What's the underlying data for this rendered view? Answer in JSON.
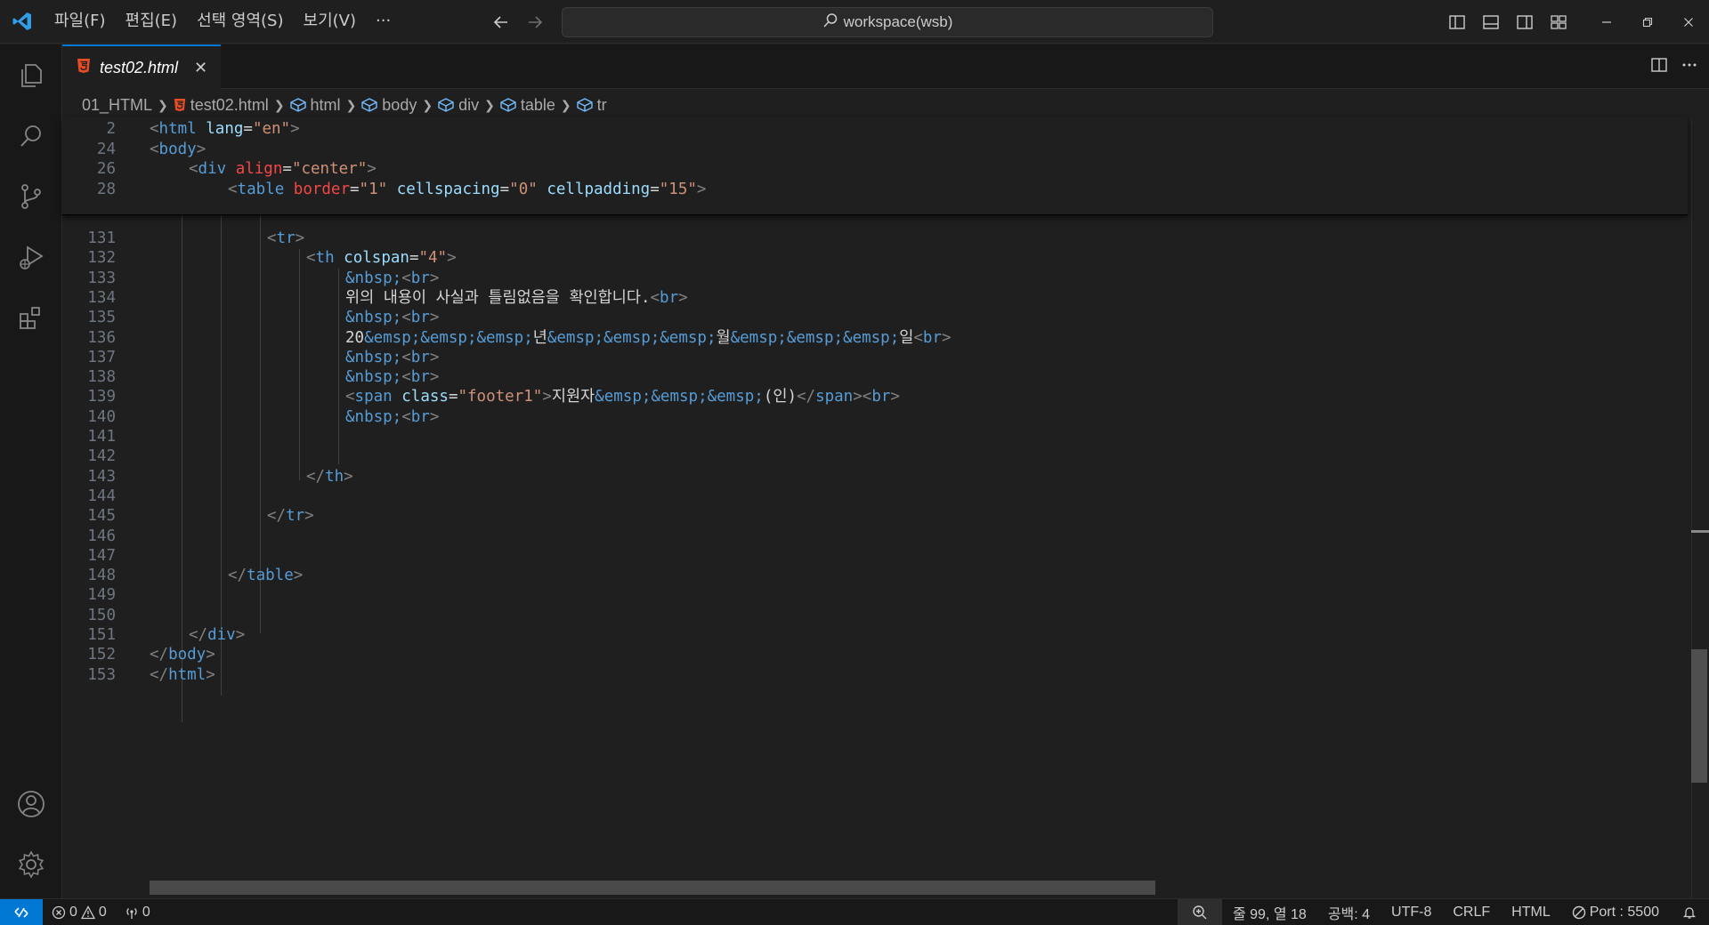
{
  "titlebar": {
    "menu": [
      "파일(F)",
      "편집(E)",
      "선택 영역(S)",
      "보기(V)",
      "···"
    ],
    "search_text": "workspace(wsb)",
    "window_controls": [
      "minimize-icon",
      "restore-icon",
      "close-icon"
    ]
  },
  "activity_bar": [
    "explorer-icon",
    "search-icon",
    "source-control-icon",
    "run-debug-icon",
    "extensions-icon",
    "account-icon",
    "settings-gear-icon"
  ],
  "tab": {
    "label": "test02.html",
    "close": "✕"
  },
  "breadcrumb": [
    "01_HTML",
    "test02.html",
    "html",
    "body",
    "div",
    "table",
    "tr"
  ],
  "sticky_lines": [
    {
      "n": "2",
      "indent": 0,
      "tokens": [
        [
          "br",
          "<"
        ],
        [
          "tag",
          "html"
        ],
        [
          "txt",
          " "
        ],
        [
          "attr",
          "lang"
        ],
        [
          "txt",
          "="
        ],
        [
          "str",
          "\"en\""
        ],
        [
          "br",
          ">"
        ]
      ]
    },
    {
      "n": "24",
      "indent": 0,
      "tokens": [
        [
          "br",
          "<"
        ],
        [
          "tag",
          "body"
        ],
        [
          "br",
          ">"
        ]
      ]
    },
    {
      "n": "26",
      "indent": 1,
      "tokens": [
        [
          "br",
          "<"
        ],
        [
          "tag",
          "div"
        ],
        [
          "txt",
          " "
        ],
        [
          "attrred",
          "align"
        ],
        [
          "txt",
          "="
        ],
        [
          "str",
          "\"center\""
        ],
        [
          "br",
          ">"
        ]
      ]
    },
    {
      "n": "28",
      "indent": 2,
      "tokens": [
        [
          "br",
          "<"
        ],
        [
          "tag",
          "table"
        ],
        [
          "txt",
          " "
        ],
        [
          "attrred",
          "border"
        ],
        [
          "txt",
          "="
        ],
        [
          "str",
          "\"1\""
        ],
        [
          "txt",
          " "
        ],
        [
          "attr",
          "cellspacing"
        ],
        [
          "txt",
          "="
        ],
        [
          "str",
          "\"0\""
        ],
        [
          "txt",
          " "
        ],
        [
          "attr",
          "cellpadding"
        ],
        [
          "txt",
          "="
        ],
        [
          "str",
          "\"15\""
        ],
        [
          "br",
          ">"
        ]
      ]
    }
  ],
  "lines": [
    {
      "n": "131",
      "indent": 3,
      "tokens": [
        [
          "br",
          "<"
        ],
        [
          "tag",
          "tr"
        ],
        [
          "br",
          ">"
        ]
      ]
    },
    {
      "n": "132",
      "indent": 4,
      "tokens": [
        [
          "br",
          "<"
        ],
        [
          "tag",
          "th"
        ],
        [
          "txt",
          " "
        ],
        [
          "attr",
          "colspan"
        ],
        [
          "txt",
          "="
        ],
        [
          "str",
          "\"4\""
        ],
        [
          "br",
          ">"
        ]
      ]
    },
    {
      "n": "133",
      "indent": 5,
      "tokens": [
        [
          "ent",
          "&nbsp;"
        ],
        [
          "br",
          "<"
        ],
        [
          "tag",
          "br"
        ],
        [
          "br",
          ">"
        ]
      ]
    },
    {
      "n": "134",
      "indent": 5,
      "tokens": [
        [
          "txt",
          "위의 내용이 사실과 틀림없음을 확인합니다."
        ],
        [
          "br",
          "<"
        ],
        [
          "tag",
          "br"
        ],
        [
          "br",
          ">"
        ]
      ]
    },
    {
      "n": "135",
      "indent": 5,
      "tokens": [
        [
          "ent",
          "&nbsp;"
        ],
        [
          "br",
          "<"
        ],
        [
          "tag",
          "br"
        ],
        [
          "br",
          ">"
        ]
      ]
    },
    {
      "n": "136",
      "indent": 5,
      "tokens": [
        [
          "txt",
          "20"
        ],
        [
          "ent",
          "&emsp;&emsp;&emsp;"
        ],
        [
          "txt",
          "년"
        ],
        [
          "ent",
          "&emsp;&emsp;&emsp;"
        ],
        [
          "txt",
          "월"
        ],
        [
          "ent",
          "&emsp;&emsp;&emsp;"
        ],
        [
          "txt",
          "일"
        ],
        [
          "br",
          "<"
        ],
        [
          "tag",
          "br"
        ],
        [
          "br",
          ">"
        ]
      ]
    },
    {
      "n": "137",
      "indent": 5,
      "tokens": [
        [
          "ent",
          "&nbsp;"
        ],
        [
          "br",
          "<"
        ],
        [
          "tag",
          "br"
        ],
        [
          "br",
          ">"
        ]
      ]
    },
    {
      "n": "138",
      "indent": 5,
      "tokens": [
        [
          "ent",
          "&nbsp;"
        ],
        [
          "br",
          "<"
        ],
        [
          "tag",
          "br"
        ],
        [
          "br",
          ">"
        ]
      ]
    },
    {
      "n": "139",
      "indent": 5,
      "tokens": [
        [
          "br",
          "<"
        ],
        [
          "tag",
          "span"
        ],
        [
          "txt",
          " "
        ],
        [
          "attr",
          "class"
        ],
        [
          "txt",
          "="
        ],
        [
          "str",
          "\"footer1\""
        ],
        [
          "br",
          ">"
        ],
        [
          "txt",
          "지원자"
        ],
        [
          "ent",
          "&emsp;&emsp;&emsp;"
        ],
        [
          "txt",
          "(인)"
        ],
        [
          "br",
          "</"
        ],
        [
          "tag",
          "span"
        ],
        [
          "br",
          ">"
        ],
        [
          "br",
          "<"
        ],
        [
          "tag",
          "br"
        ],
        [
          "br",
          ">"
        ]
      ]
    },
    {
      "n": "140",
      "indent": 5,
      "tokens": [
        [
          "ent",
          "&nbsp;"
        ],
        [
          "br",
          "<"
        ],
        [
          "tag",
          "br"
        ],
        [
          "br",
          ">"
        ]
      ]
    },
    {
      "n": "141",
      "indent": 0,
      "tokens": []
    },
    {
      "n": "142",
      "indent": 0,
      "tokens": []
    },
    {
      "n": "143",
      "indent": 4,
      "tokens": [
        [
          "br",
          "</"
        ],
        [
          "tag",
          "th"
        ],
        [
          "br",
          ">"
        ]
      ]
    },
    {
      "n": "144",
      "indent": 0,
      "tokens": []
    },
    {
      "n": "145",
      "indent": 3,
      "tokens": [
        [
          "br",
          "</"
        ],
        [
          "tag",
          "tr"
        ],
        [
          "br",
          ">"
        ]
      ]
    },
    {
      "n": "146",
      "indent": 0,
      "tokens": []
    },
    {
      "n": "147",
      "indent": 0,
      "tokens": []
    },
    {
      "n": "148",
      "indent": 2,
      "tokens": [
        [
          "br",
          "</"
        ],
        [
          "tag",
          "table"
        ],
        [
          "br",
          ">"
        ]
      ]
    },
    {
      "n": "149",
      "indent": 0,
      "tokens": []
    },
    {
      "n": "150",
      "indent": 0,
      "tokens": []
    },
    {
      "n": "151",
      "indent": 1,
      "tokens": [
        [
          "br",
          "</"
        ],
        [
          "tag",
          "div"
        ],
        [
          "br",
          ">"
        ]
      ]
    },
    {
      "n": "152",
      "indent": 0,
      "tokens": [
        [
          "br",
          "</"
        ],
        [
          "tag",
          "body"
        ],
        [
          "br",
          ">"
        ]
      ]
    },
    {
      "n": "153",
      "indent": 0,
      "tokens": [
        [
          "br",
          "</"
        ],
        [
          "tag",
          "html"
        ],
        [
          "br",
          ">"
        ]
      ]
    }
  ],
  "statusbar": {
    "errors": "0",
    "warnings": "0",
    "ports": "0",
    "position": "줄 99, 열 18",
    "spaces": "공백: 4",
    "encoding": "UTF-8",
    "eol": "CRLF",
    "language": "HTML",
    "port": "Port : 5500"
  },
  "colors": {
    "accent": "#0078d4",
    "html_icon": "#e44d26",
    "tag": "#569cd6",
    "attribute": "#9cdcfe",
    "string": "#ce9178"
  }
}
